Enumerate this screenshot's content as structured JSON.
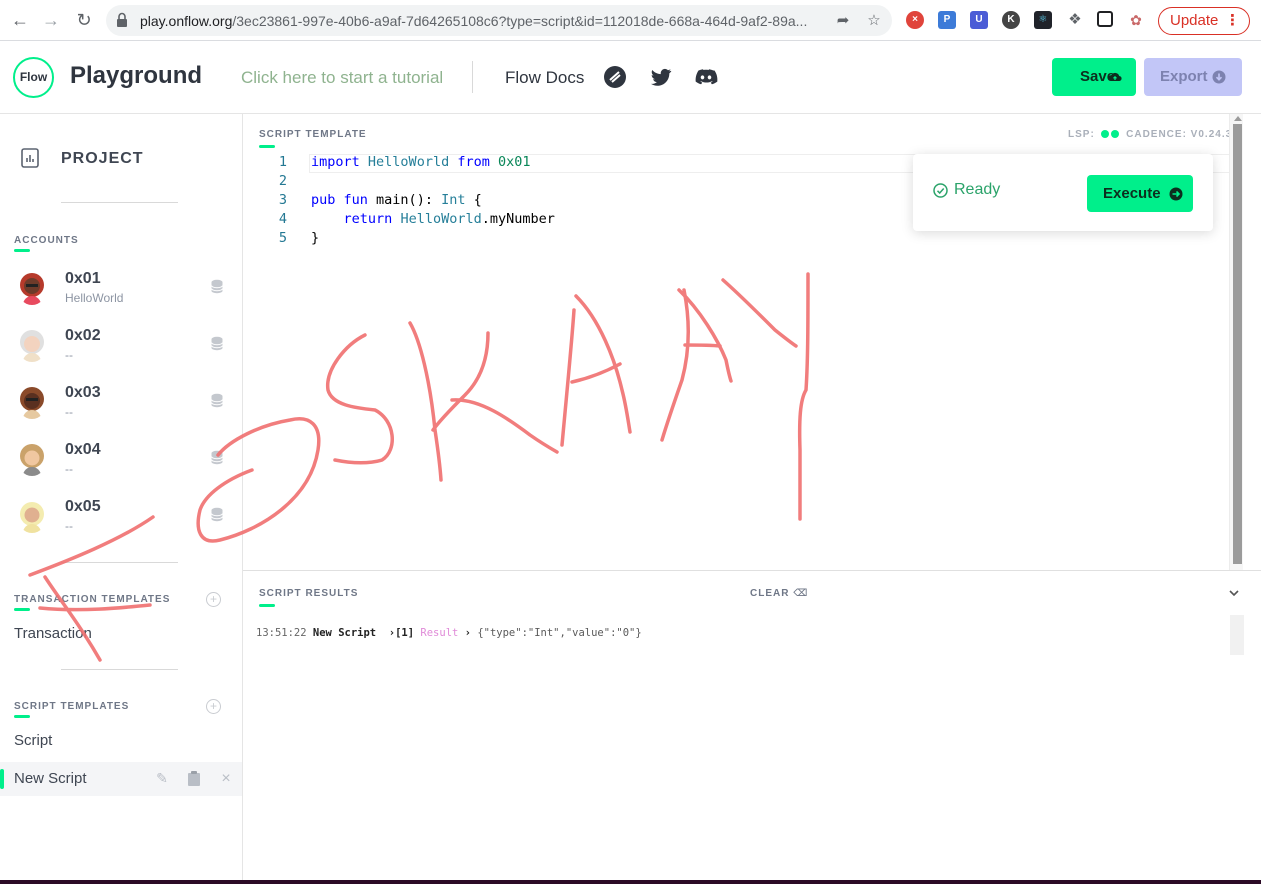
{
  "browser": {
    "url_host": "play.onflow.org",
    "url_path": "/3ec23861-997e-40b6-a9af-7d64265108c6?type=script&id=112018de-668a-464d-9af2-89a...",
    "update_label": "Update"
  },
  "header": {
    "logo_text": "Flow",
    "title": "Playground",
    "tutorial_link": "Click here to start a tutorial",
    "docs_link": "Flow Docs",
    "save_label": "Save",
    "export_label": "Export"
  },
  "sidebar": {
    "project_label": "PROJECT",
    "accounts_title": "ACCOUNTS",
    "accounts": [
      {
        "address": "0x01",
        "name": "HelloWorld"
      },
      {
        "address": "0x02",
        "name": "--"
      },
      {
        "address": "0x03",
        "name": "--"
      },
      {
        "address": "0x04",
        "name": "--"
      },
      {
        "address": "0x05",
        "name": "--"
      }
    ],
    "transaction_templates_title": "TRANSACTION TEMPLATES",
    "transaction_items": [
      "Transaction"
    ],
    "script_templates_title": "SCRIPT TEMPLATES",
    "script_items": [
      "Script",
      "New Script"
    ]
  },
  "editor": {
    "title": "SCRIPT TEMPLATE",
    "lsp_label": "LSP:",
    "cadence_label": "CADENCE: V0.24.3",
    "line_numbers": [
      "1",
      "2",
      "3",
      "4",
      "5"
    ]
  },
  "run_panel": {
    "status": "Ready",
    "execute_label": "Execute"
  },
  "results": {
    "title": "SCRIPT RESULTS",
    "clear_label": "CLEAR",
    "log_time": "13:51:22",
    "log_script": "New Script",
    "log_index": "[1]",
    "log_result_label": "Result",
    "log_value": "{\"type\":\"Int\",\"value\":\"0\"}"
  },
  "colors": {
    "accent": "#00ef8b",
    "export_bg": "#c2c6f7",
    "annotation": "#f07070"
  }
}
